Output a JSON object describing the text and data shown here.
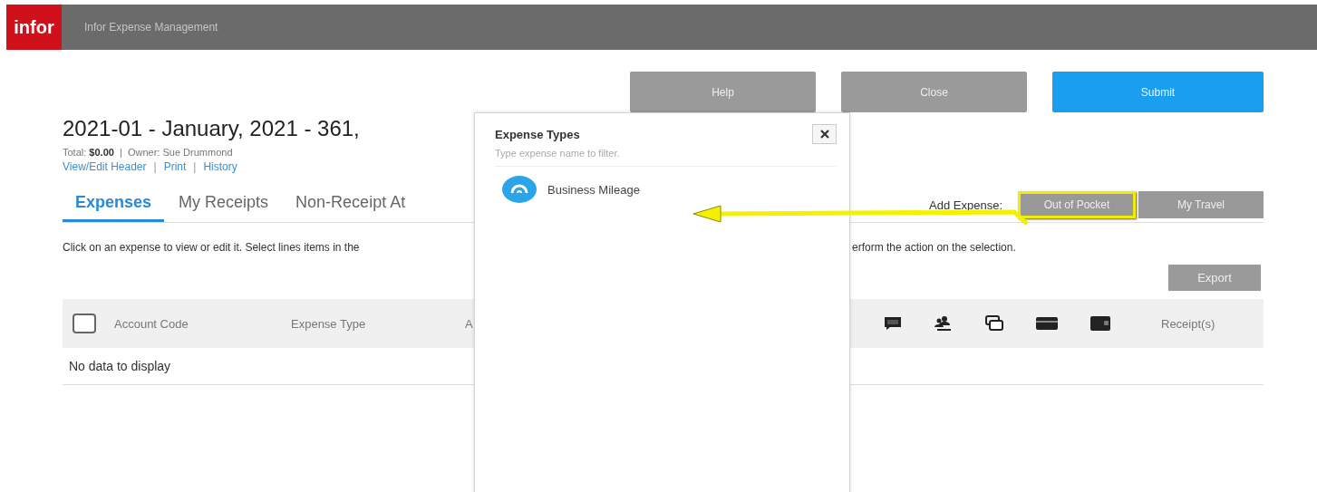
{
  "app": {
    "logo": "infor",
    "title": "Infor Expense Management"
  },
  "actions": [
    {
      "label": "Help",
      "kind": "secondary"
    },
    {
      "label": "Close",
      "kind": "secondary"
    },
    {
      "label": "Submit",
      "kind": "primary"
    }
  ],
  "report": {
    "title": "2021-01 - January, 2021 - 361,",
    "summary": "Total: **$0.00**  |  Owner: Sue Drummond",
    "links": [
      "View/Edit Header",
      "Print",
      "History"
    ],
    "separator": "|"
  },
  "tabs": [
    {
      "label": "Expenses",
      "selected": true
    },
    {
      "label": "My Receipts",
      "selected": false
    },
    {
      "label": "Non-Receipt At",
      "selected": false
    }
  ],
  "add_expense": {
    "label": "Add Expense:",
    "options": [
      {
        "label": "Out of Pocket",
        "highlighted": true
      },
      {
        "label": "My Travel",
        "highlighted": false
      }
    ]
  },
  "instructions": {
    "left": "Click on an expense to view or edit it. Select lines items in the",
    "right": "erform the action on the selection."
  },
  "export_button": "Export",
  "table": {
    "select_all_checked": false,
    "columns_left": [
      "Account Code",
      "Expense Type",
      "A"
    ],
    "columns_right": [
      "Receipt(s)"
    ],
    "empty_message": "No data to display"
  },
  "popup": {
    "title": "Expense Types",
    "placeholder": "Type expense name to filter.",
    "items": [
      {
        "label": "Business Mileage"
      }
    ]
  }
}
